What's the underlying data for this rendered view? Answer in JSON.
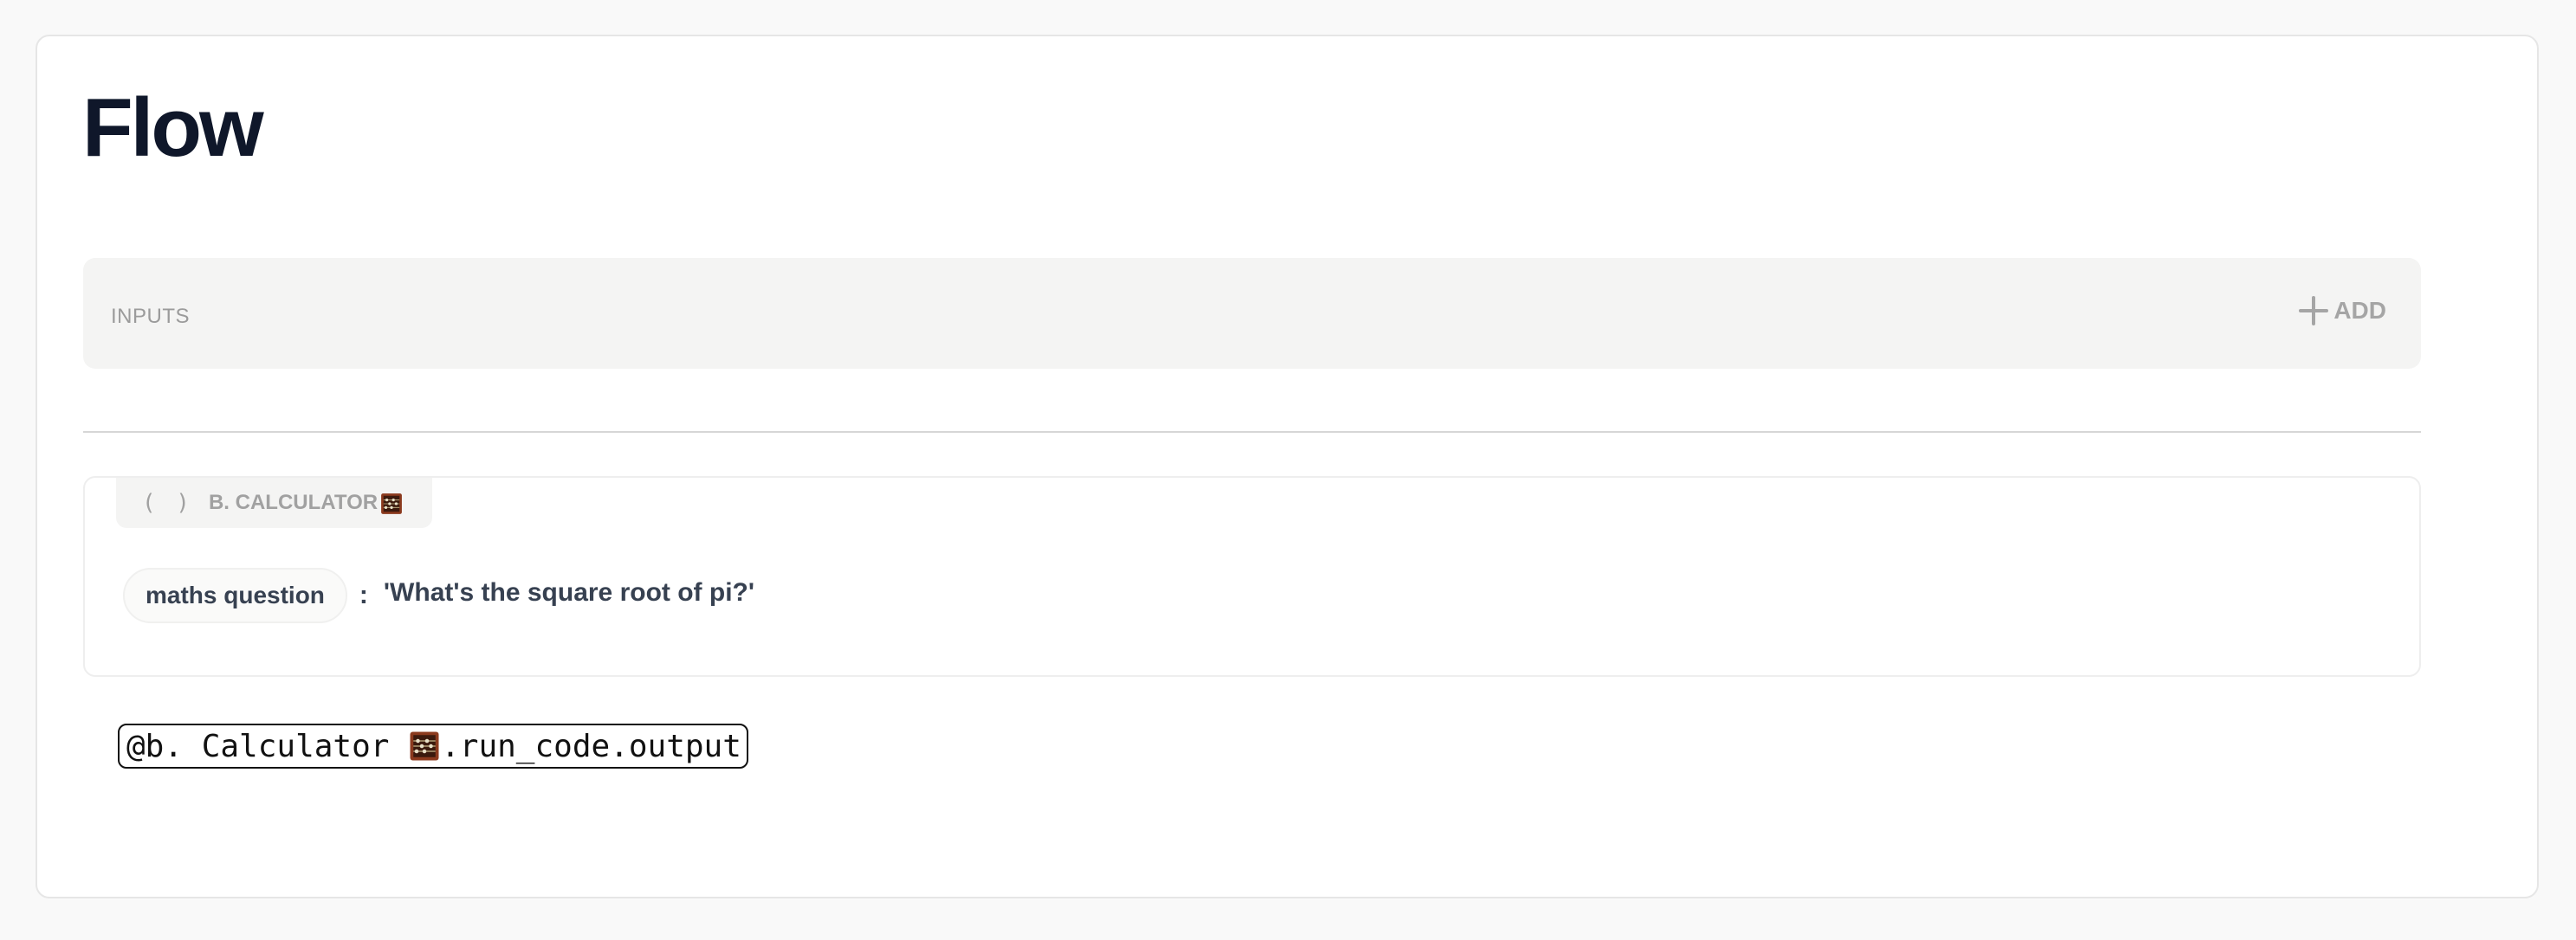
{
  "page": {
    "title": "Flow"
  },
  "inputs": {
    "label": "INPUTS",
    "add_label": "ADD"
  },
  "calculator_block": {
    "func_symbol": "( )",
    "name": "B. CALCULATOR",
    "name_icon": "abacus-icon",
    "parameter": {
      "name": "maths question",
      "separator": ":",
      "value": "'What's the square root of pi?'"
    }
  },
  "output_reference": {
    "prefix": "@b. Calculator ",
    "icon": "abacus-icon",
    "suffix": ".run_code.output"
  },
  "colors": {
    "title": "#0f172a",
    "muted": "#a1a1a1",
    "bar_bg": "#f4f4f3",
    "abacus_frame": "#8b3a1e",
    "abacus_bead": "#e8e0c8"
  }
}
